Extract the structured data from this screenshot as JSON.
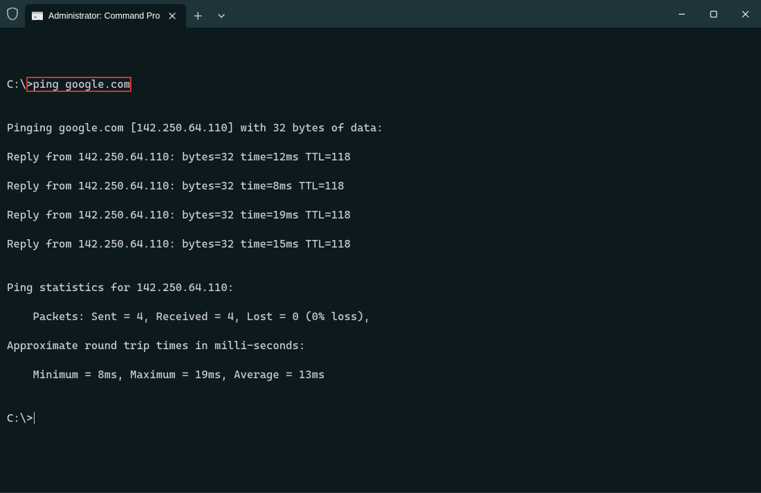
{
  "titlebar": {
    "tab_title": "Administrator: Command Pro",
    "app_icon_alt": "shield-icon",
    "tab_icon_alt": "cmd-icon"
  },
  "terminal": {
    "prompt1_prefix": "C:\\>",
    "command": "ping google.com",
    "blank": "",
    "line_ping_header": "Pinging google.com [142.250.64.110] with 32 bytes of data:",
    "reply1": "Reply from 142.250.64.110: bytes=32 time=12ms TTL=118",
    "reply2": "Reply from 142.250.64.110: bytes=32 time=8ms TTL=118",
    "reply3": "Reply from 142.250.64.110: bytes=32 time=19ms TTL=118",
    "reply4": "Reply from 142.250.64.110: bytes=32 time=15ms TTL=118",
    "stats_header": "Ping statistics for 142.250.64.110:",
    "stats_packets": "    Packets: Sent = 4, Received = 4, Lost = 0 (0% loss),",
    "approx_header": "Approximate round trip times in milli-seconds:",
    "approx_values": "    Minimum = 8ms, Maximum = 19ms, Average = 13ms",
    "prompt2_prefix": "C:\\>"
  }
}
